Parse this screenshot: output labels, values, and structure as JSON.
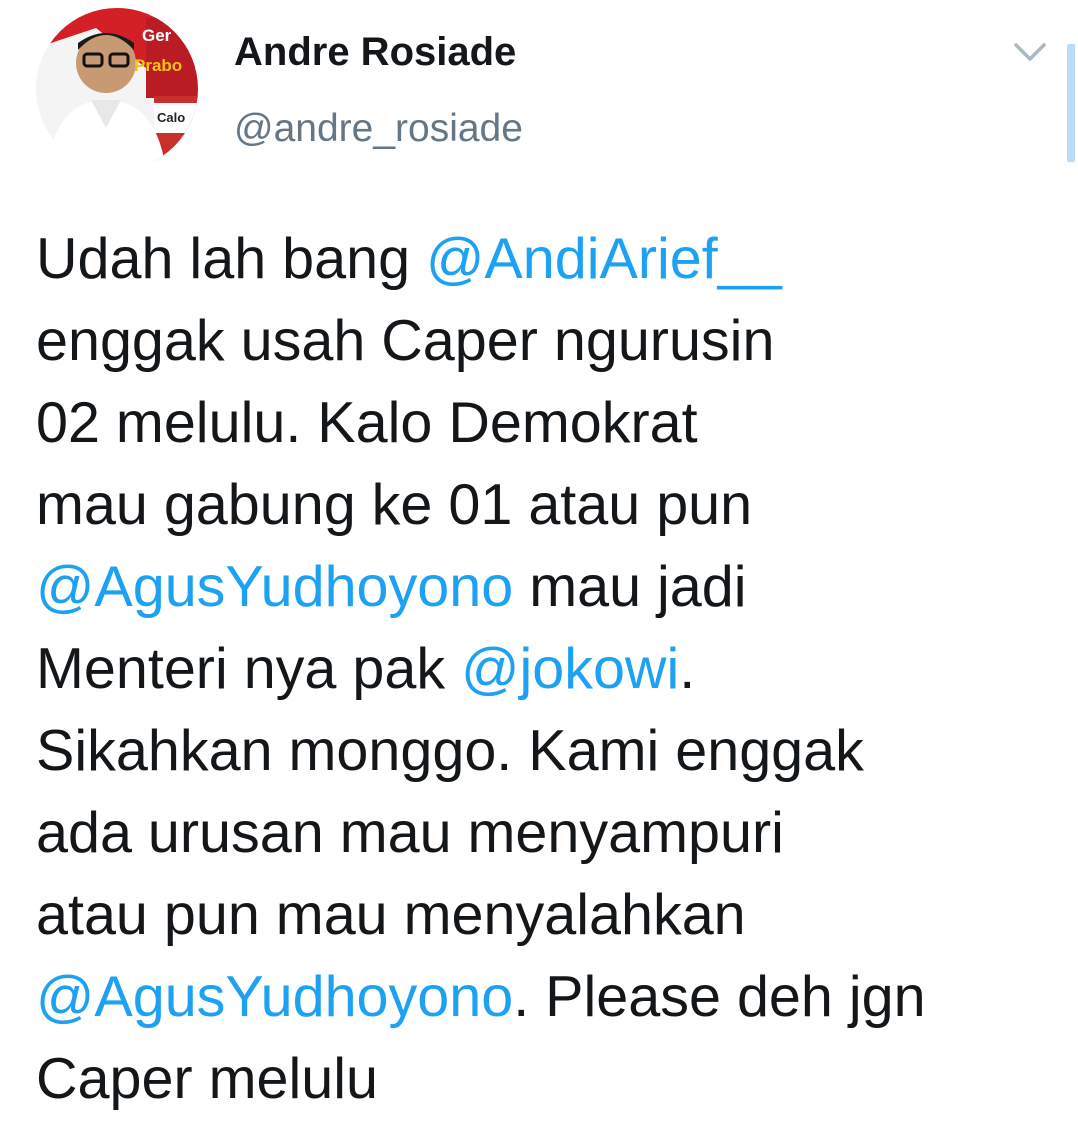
{
  "tweet": {
    "author": {
      "name": "Andre Rosiade",
      "handle": "@andre_rosiade",
      "avatar_text": [
        "Ger",
        "Prabo",
        "Calo"
      ]
    },
    "colors": {
      "text": "#14171a",
      "handle": "#657786",
      "mention": "#1da1f2"
    },
    "menu_icon": "chevron-down-icon",
    "lines": [
      [
        {
          "t": "Udah lah bang "
        },
        {
          "t": "@AndiArief__",
          "m": true
        }
      ],
      [
        {
          "t": "enggak usah Caper ngurusin"
        }
      ],
      [
        {
          "t": "02 melulu. Kalo Demokrat"
        }
      ],
      [
        {
          "t": "mau gabung ke 01 atau pun"
        }
      ],
      [
        {
          "t": "@AgusYudhoyono",
          "m": true
        },
        {
          "t": " mau jadi"
        }
      ],
      [
        {
          "t": "Menteri nya pak "
        },
        {
          "t": "@jokowi",
          "m": true
        },
        {
          "t": "."
        }
      ],
      [
        {
          "t": "Sikahkan monggo. Kami enggak"
        }
      ],
      [
        {
          "t": "ada urusan mau menyampuri"
        }
      ],
      [
        {
          "t": "atau pun mau menyalahkan"
        }
      ],
      [
        {
          "t": "@AgusYudhoyono",
          "m": true
        },
        {
          "t": ". Please deh jgn"
        }
      ],
      [
        {
          "t": "Caper melulu"
        }
      ]
    ]
  }
}
